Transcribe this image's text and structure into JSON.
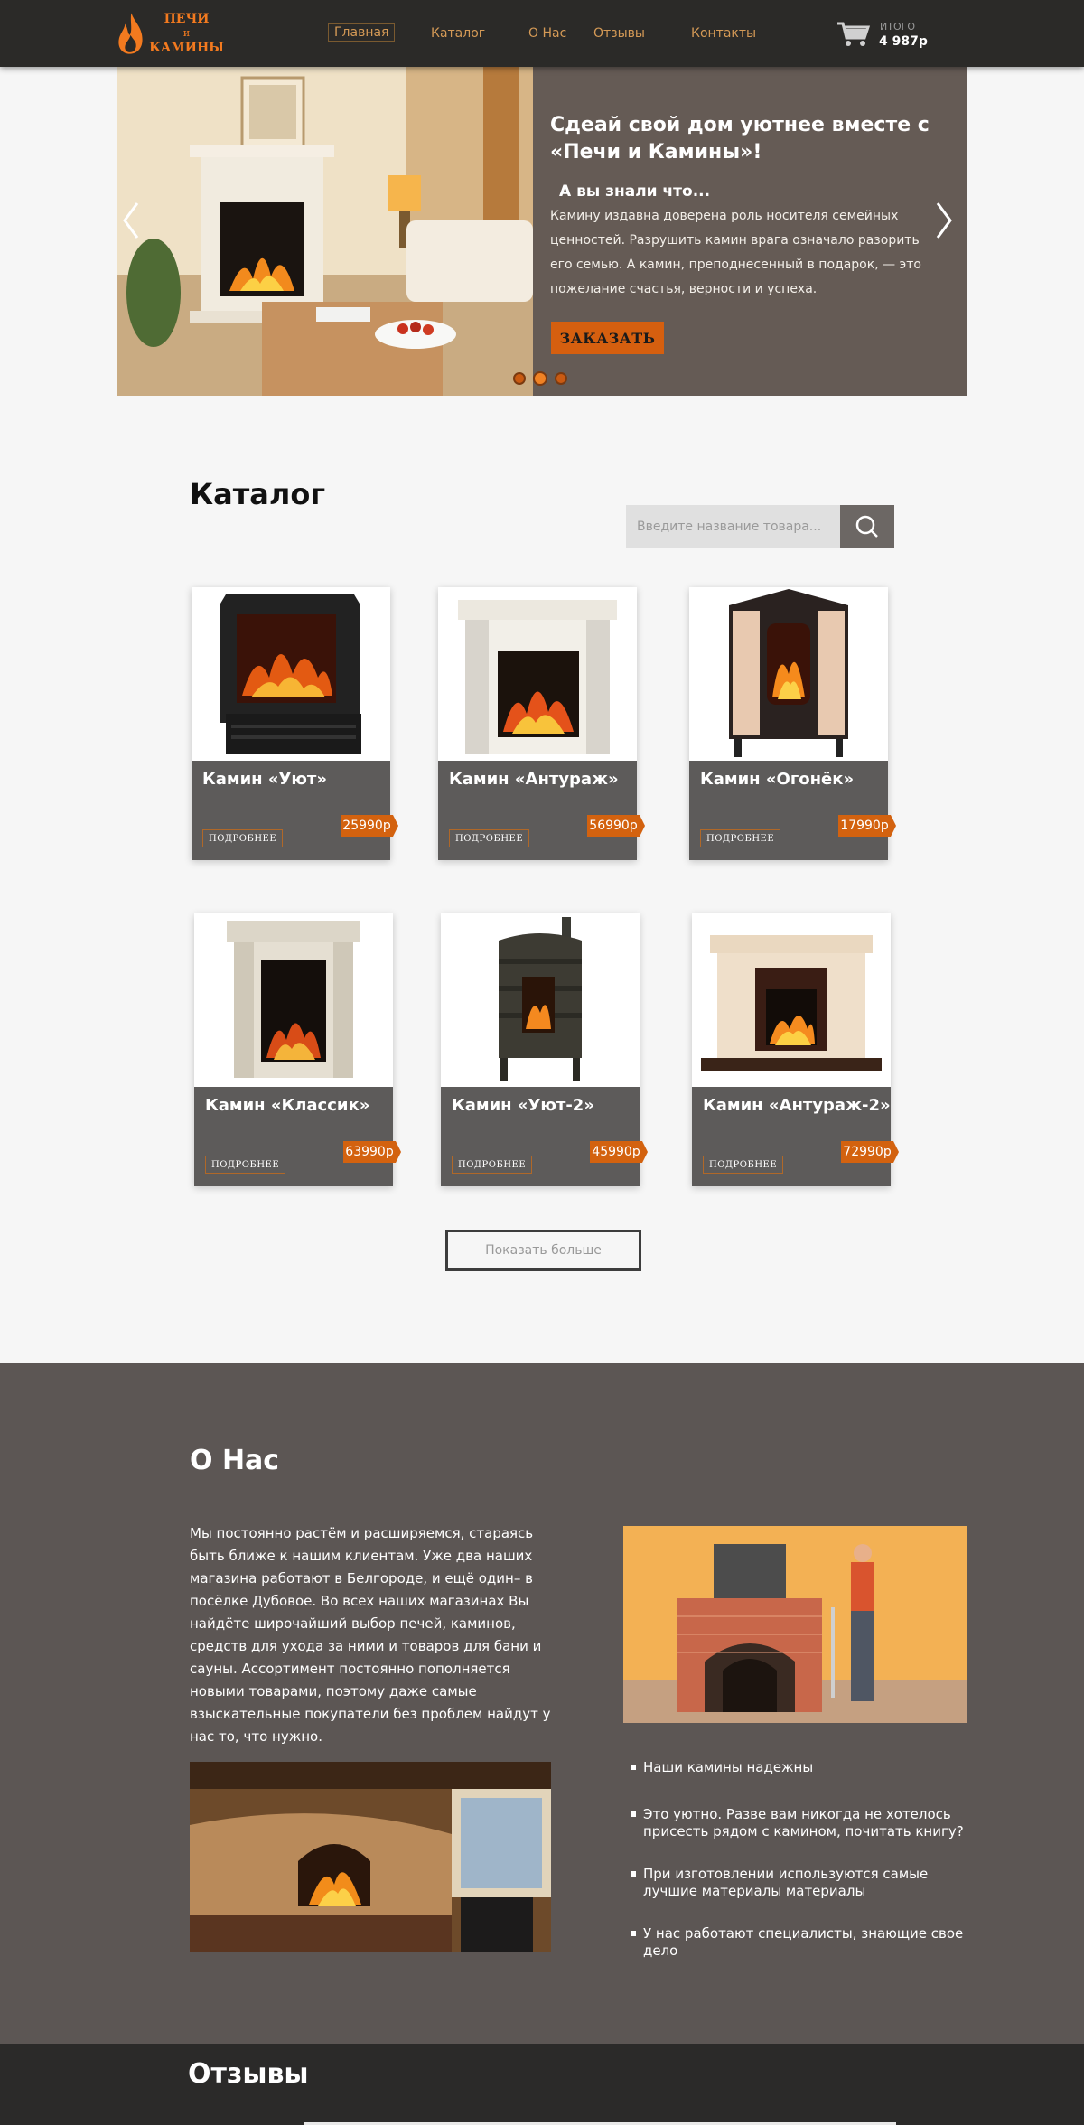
{
  "header": {
    "logo": {
      "line1": "ПЕЧИ",
      "line2": "и",
      "line3": "КАМИНЫ"
    },
    "nav": [
      {
        "label": "Главная",
        "active": true
      },
      {
        "label": "Каталог"
      },
      {
        "label": "О Нас"
      },
      {
        "label": "Отзывы"
      },
      {
        "label": "Контакты"
      }
    ],
    "cart": {
      "label": "ИТОГО",
      "total": "4 987р"
    }
  },
  "hero": {
    "title": "Сдеай свой дом уютнее вместе с «Печи и Камины»!",
    "subtitle": "А вы знали что...",
    "text": "Камину издавна доверена роль носителя семейных ценностей. Разрушить камин врага означало разорить его семью. А камин, преподнесенный в подарок, — это пожелание счастья, верности и успеха.",
    "button": "ЗАКАЗАТЬ",
    "slides": 3,
    "active_slide": 2
  },
  "catalog": {
    "title": "Каталог",
    "search_placeholder": "Введите название товара...",
    "more_label": "ПОДРОБНЕЕ",
    "items": [
      {
        "name": "Камин «Уют»",
        "price": "25990р"
      },
      {
        "name": "Камин «Антураж»",
        "price": "56990р"
      },
      {
        "name": "Камин «Огонёк»",
        "price": "17990р"
      },
      {
        "name": "Камин «Классик»",
        "price": "63990р"
      },
      {
        "name": "Камин «Уют-2»",
        "price": "45990р"
      },
      {
        "name": "Камин «Антураж-2»",
        "price": "72990р"
      }
    ],
    "show_more": "Показать больше"
  },
  "about": {
    "title": "О Нас",
    "text": "Мы постоянно растём и расширяемся, стараясь быть ближе к нашим клиентам. Уже два наших магазина работают в Белгороде, и ещё один– в посёлке Дубовое. Во всех наших магазинах Вы найдёте широчайший выбор печей, каминов, средств для ухода за ними и товаров для бани и сауны. Ассортимент постоянно пополняется новыми товарами, поэтому даже самые взыскательные покупатели без проблем найдут у нас то, что нужно.",
    "features": [
      "Наши камины надежны",
      "Это уютно. Разве вам никогда не хотелось присесть рядом с камином, почитать книгу?",
      "При изготовлении используются самые лучшие материалы материалы",
      "У нас работают специалисты, знающие свое дело"
    ]
  },
  "reviews": {
    "title": "Отзывы"
  },
  "colors": {
    "accent": "#d3620f",
    "header": "#2b2a28",
    "about_bg": "#5c5654"
  }
}
